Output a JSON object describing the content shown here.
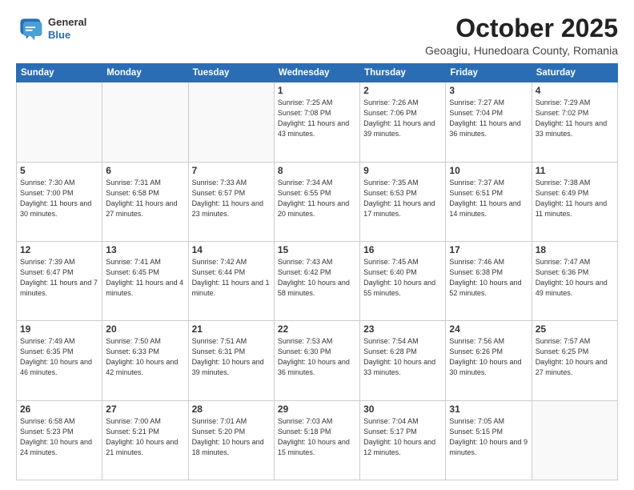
{
  "header": {
    "logo_general": "General",
    "logo_blue": "Blue",
    "month_title": "October 2025",
    "subtitle": "Geoagiu, Hunedoara County, Romania"
  },
  "days_of_week": [
    "Sunday",
    "Monday",
    "Tuesday",
    "Wednesday",
    "Thursday",
    "Friday",
    "Saturday"
  ],
  "weeks": [
    [
      {
        "day": "",
        "info": ""
      },
      {
        "day": "",
        "info": ""
      },
      {
        "day": "",
        "info": ""
      },
      {
        "day": "1",
        "info": "Sunrise: 7:25 AM\nSunset: 7:08 PM\nDaylight: 11 hours\nand 43 minutes."
      },
      {
        "day": "2",
        "info": "Sunrise: 7:26 AM\nSunset: 7:06 PM\nDaylight: 11 hours\nand 39 minutes."
      },
      {
        "day": "3",
        "info": "Sunrise: 7:27 AM\nSunset: 7:04 PM\nDaylight: 11 hours\nand 36 minutes."
      },
      {
        "day": "4",
        "info": "Sunrise: 7:29 AM\nSunset: 7:02 PM\nDaylight: 11 hours\nand 33 minutes."
      }
    ],
    [
      {
        "day": "5",
        "info": "Sunrise: 7:30 AM\nSunset: 7:00 PM\nDaylight: 11 hours\nand 30 minutes."
      },
      {
        "day": "6",
        "info": "Sunrise: 7:31 AM\nSunset: 6:58 PM\nDaylight: 11 hours\nand 27 minutes."
      },
      {
        "day": "7",
        "info": "Sunrise: 7:33 AM\nSunset: 6:57 PM\nDaylight: 11 hours\nand 23 minutes."
      },
      {
        "day": "8",
        "info": "Sunrise: 7:34 AM\nSunset: 6:55 PM\nDaylight: 11 hours\nand 20 minutes."
      },
      {
        "day": "9",
        "info": "Sunrise: 7:35 AM\nSunset: 6:53 PM\nDaylight: 11 hours\nand 17 minutes."
      },
      {
        "day": "10",
        "info": "Sunrise: 7:37 AM\nSunset: 6:51 PM\nDaylight: 11 hours\nand 14 minutes."
      },
      {
        "day": "11",
        "info": "Sunrise: 7:38 AM\nSunset: 6:49 PM\nDaylight: 11 hours\nand 11 minutes."
      }
    ],
    [
      {
        "day": "12",
        "info": "Sunrise: 7:39 AM\nSunset: 6:47 PM\nDaylight: 11 hours\nand 7 minutes."
      },
      {
        "day": "13",
        "info": "Sunrise: 7:41 AM\nSunset: 6:45 PM\nDaylight: 11 hours\nand 4 minutes."
      },
      {
        "day": "14",
        "info": "Sunrise: 7:42 AM\nSunset: 6:44 PM\nDaylight: 11 hours\nand 1 minute."
      },
      {
        "day": "15",
        "info": "Sunrise: 7:43 AM\nSunset: 6:42 PM\nDaylight: 10 hours\nand 58 minutes."
      },
      {
        "day": "16",
        "info": "Sunrise: 7:45 AM\nSunset: 6:40 PM\nDaylight: 10 hours\nand 55 minutes."
      },
      {
        "day": "17",
        "info": "Sunrise: 7:46 AM\nSunset: 6:38 PM\nDaylight: 10 hours\nand 52 minutes."
      },
      {
        "day": "18",
        "info": "Sunrise: 7:47 AM\nSunset: 6:36 PM\nDaylight: 10 hours\nand 49 minutes."
      }
    ],
    [
      {
        "day": "19",
        "info": "Sunrise: 7:49 AM\nSunset: 6:35 PM\nDaylight: 10 hours\nand 46 minutes."
      },
      {
        "day": "20",
        "info": "Sunrise: 7:50 AM\nSunset: 6:33 PM\nDaylight: 10 hours\nand 42 minutes."
      },
      {
        "day": "21",
        "info": "Sunrise: 7:51 AM\nSunset: 6:31 PM\nDaylight: 10 hours\nand 39 minutes."
      },
      {
        "day": "22",
        "info": "Sunrise: 7:53 AM\nSunset: 6:30 PM\nDaylight: 10 hours\nand 36 minutes."
      },
      {
        "day": "23",
        "info": "Sunrise: 7:54 AM\nSunset: 6:28 PM\nDaylight: 10 hours\nand 33 minutes."
      },
      {
        "day": "24",
        "info": "Sunrise: 7:56 AM\nSunset: 6:26 PM\nDaylight: 10 hours\nand 30 minutes."
      },
      {
        "day": "25",
        "info": "Sunrise: 7:57 AM\nSunset: 6:25 PM\nDaylight: 10 hours\nand 27 minutes."
      }
    ],
    [
      {
        "day": "26",
        "info": "Sunrise: 6:58 AM\nSunset: 5:23 PM\nDaylight: 10 hours\nand 24 minutes."
      },
      {
        "day": "27",
        "info": "Sunrise: 7:00 AM\nSunset: 5:21 PM\nDaylight: 10 hours\nand 21 minutes."
      },
      {
        "day": "28",
        "info": "Sunrise: 7:01 AM\nSunset: 5:20 PM\nDaylight: 10 hours\nand 18 minutes."
      },
      {
        "day": "29",
        "info": "Sunrise: 7:03 AM\nSunset: 5:18 PM\nDaylight: 10 hours\nand 15 minutes."
      },
      {
        "day": "30",
        "info": "Sunrise: 7:04 AM\nSunset: 5:17 PM\nDaylight: 10 hours\nand 12 minutes."
      },
      {
        "day": "31",
        "info": "Sunrise: 7:05 AM\nSunset: 5:15 PM\nDaylight: 10 hours\nand 9 minutes."
      },
      {
        "day": "",
        "info": ""
      }
    ]
  ]
}
